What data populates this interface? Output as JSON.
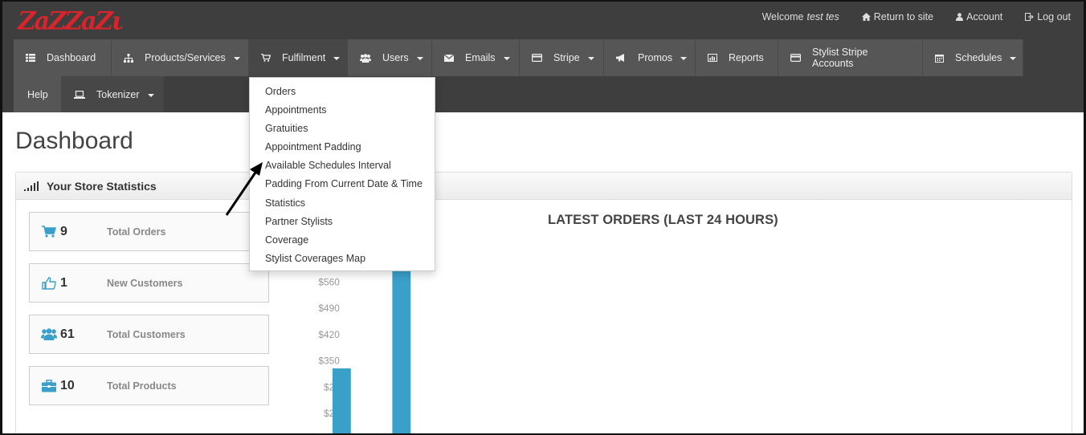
{
  "brand": {
    "name": "ZaZZaZu",
    "color": "#d8242b"
  },
  "top_links": {
    "welcome_prefix": "Welcome",
    "welcome_user": "test tes",
    "return": "Return to site",
    "account": "Account",
    "logout": "Log out"
  },
  "nav": {
    "row1": [
      {
        "label": "Dashboard",
        "icon": "list-icon",
        "caret": false
      },
      {
        "label": "Products/Services",
        "icon": "sitemap-icon",
        "caret": true
      },
      {
        "label": "Fulfilment",
        "icon": "cart-icon",
        "caret": true,
        "active": true
      },
      {
        "label": "Users",
        "icon": "users-icon",
        "caret": true
      },
      {
        "label": "Emails",
        "icon": "envelope-icon",
        "caret": true
      },
      {
        "label": "Stripe",
        "icon": "credit-card-icon",
        "caret": true
      },
      {
        "label": "Promos",
        "icon": "bullhorn-icon",
        "caret": true
      },
      {
        "label": "Reports",
        "icon": "bar-chart-icon",
        "caret": false
      },
      {
        "label": "Stylist Stripe Accounts",
        "icon": "credit-card-icon",
        "caret": false
      },
      {
        "label": "Schedules",
        "icon": "calendar-icon",
        "caret": true
      }
    ],
    "row2": [
      {
        "label": "Help",
        "icon": "",
        "caret": false
      },
      {
        "label": "Tokenizer",
        "icon": "laptop-icon",
        "caret": true
      }
    ]
  },
  "dropdown": {
    "items": [
      "Orders",
      "Appointments",
      "Gratuities",
      "Appointment Padding",
      "Available Schedules Interval",
      "Padding From Current Date & Time",
      "Statistics",
      "Partner Stylists",
      "Coverage",
      "Stylist Coverages Map"
    ]
  },
  "page": {
    "title": "Dashboard"
  },
  "panel": {
    "title": "Your Store Statistics"
  },
  "stats": [
    {
      "value": "9",
      "label": "Total Orders",
      "icon": "cart-icon"
    },
    {
      "value": "1",
      "label": "New Customers",
      "icon": "thumbs-up-icon"
    },
    {
      "value": "61",
      "label": "Total Customers",
      "icon": "users-icon"
    },
    {
      "value": "10",
      "label": "Total Products",
      "icon": "briefcase-icon"
    }
  ],
  "accent_color": "#3aa0c9",
  "chart_data": {
    "type": "bar",
    "title": "LATEST ORDERS (LAST 24 HOURS)",
    "y_ticks": [
      "$560",
      "$490",
      "$420",
      "$350",
      "$28",
      "$21"
    ],
    "y_tick_values": [
      560,
      490,
      420,
      350,
      280,
      210
    ],
    "series": [
      {
        "values": [
          330,
          690
        ]
      }
    ],
    "ylim": [
      210,
      560
    ]
  }
}
